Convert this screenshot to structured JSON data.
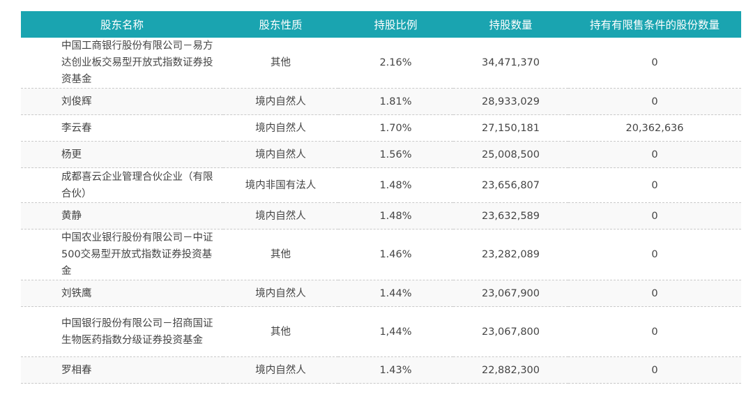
{
  "table": {
    "headers": [
      "股东名称",
      "股东性质",
      "持股比例",
      "持股数量",
      "持有有限售条件的股份数量"
    ],
    "rows": [
      {
        "name": "中国工商银行股份有限公司－易方达创业板交易型开放式指数证券投资基金",
        "type": "其他",
        "ratio": "2.16%",
        "shares": "34,471,370",
        "restricted": "0"
      },
      {
        "name": "刘俊辉",
        "type": "境内自然人",
        "ratio": "1.81%",
        "shares": "28,933,029",
        "restricted": "0"
      },
      {
        "name": "李云春",
        "type": "境内自然人",
        "ratio": "1.70%",
        "shares": "27,150,181",
        "restricted": "20,362,636"
      },
      {
        "name": "杨更",
        "type": "境内自然人",
        "ratio": "1.56%",
        "shares": "25,008,500",
        "restricted": "0"
      },
      {
        "name": "成都喜云企业管理合伙企业（有限合伙）",
        "type": "境内非国有法人",
        "ratio": "1.48%",
        "shares": "23,656,807",
        "restricted": "0"
      },
      {
        "name": "黄静",
        "type": "境内自然人",
        "ratio": "1.48%",
        "shares": "23,632,589",
        "restricted": "0"
      },
      {
        "name": "中国农业银行股份有限公司－中证500交易型开放式指数证券投资基金",
        "type": "其他",
        "ratio": "1.46%",
        "shares": "23,282,089",
        "restricted": "0"
      },
      {
        "name": "刘铁鹰",
        "type": "境内自然人",
        "ratio": "1.44%",
        "shares": "23,067,900",
        "restricted": "0"
      },
      {
        "name": "中国银行股份有限公司－招商国证生物医药指数分级证券投资基金",
        "type": "其他",
        "ratio": "1,44%",
        "shares": "23,067,800",
        "restricted": "0"
      },
      {
        "name": "罗相春",
        "type": "境内自然人",
        "ratio": "1.43%",
        "shares": "22,882,300",
        "restricted": "0"
      }
    ]
  }
}
